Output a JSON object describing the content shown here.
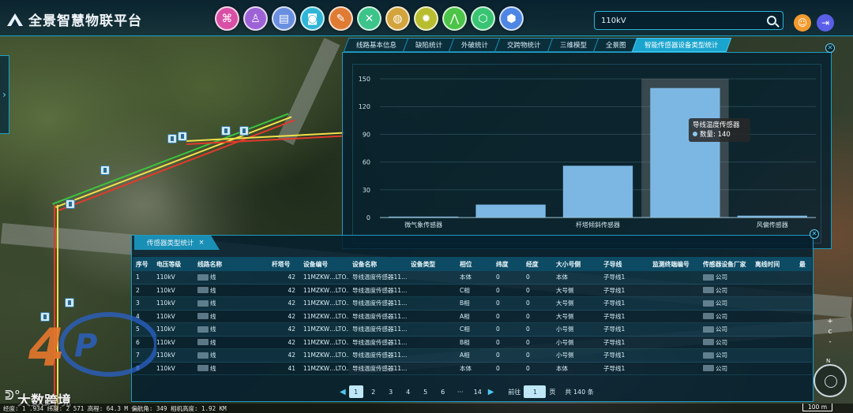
{
  "app": {
    "title": "全景智慧物联平台"
  },
  "nav_icons": [
    {
      "name": "network-icon",
      "color": "#d84fa5",
      "glyph": "⌘"
    },
    {
      "name": "person-icon",
      "color": "#9d63d6",
      "glyph": "♙"
    },
    {
      "name": "layers-icon",
      "color": "#6a8fe0",
      "glyph": "▤"
    },
    {
      "name": "camera-icon",
      "color": "#2fb5d6",
      "glyph": "◙"
    },
    {
      "name": "stamp-icon",
      "color": "#e07b34",
      "glyph": "✎"
    },
    {
      "name": "tools-icon",
      "color": "#3cc48a",
      "glyph": "✕"
    },
    {
      "name": "globe-icon",
      "color": "#d3a43c",
      "glyph": "◍"
    },
    {
      "name": "gear-icon",
      "color": "#b7bd2f",
      "glyph": "✹"
    },
    {
      "name": "line-chart-icon",
      "color": "#4bc447",
      "glyph": "⋀"
    },
    {
      "name": "cube-icon",
      "color": "#39c473",
      "glyph": "⬡"
    },
    {
      "name": "shield-icon",
      "color": "#4e86e3",
      "glyph": "⬢"
    }
  ],
  "search": {
    "value": "110kV"
  },
  "tabs": [
    {
      "label": "线路基本信息",
      "active": false
    },
    {
      "label": "缺陷统计",
      "active": false
    },
    {
      "label": "外破统计",
      "active": false
    },
    {
      "label": "交跨物统计",
      "active": false
    },
    {
      "label": "三维模型",
      "active": false
    },
    {
      "label": "全景图",
      "active": false
    },
    {
      "label": "智能传感器设备类型统计",
      "active": true
    }
  ],
  "chart_data": {
    "type": "bar",
    "categories": [
      "微气象传感器",
      "",
      "杆塔倾斜传感器",
      "导线温度传感器",
      "风偏传感器"
    ],
    "x_tick_labels_shown": [
      "微气象传感器",
      "杆塔倾斜传感器",
      "风偏传感器"
    ],
    "values": [
      1,
      14,
      56,
      140,
      2
    ],
    "ylim": [
      0,
      150
    ],
    "yticks": [
      0,
      30,
      60,
      90,
      120,
      150
    ],
    "highlight_index": 3,
    "bar_color": "#7cb7e3",
    "grid": true,
    "tooltip": {
      "title": "导线温度传感器",
      "label": "数量",
      "value": "140"
    }
  },
  "table": {
    "tab_label": "传感器类型统计",
    "columns": [
      "序号",
      "电压等级",
      "线路名称",
      "杆塔号",
      "设备编号",
      "设备名称",
      "设备类型",
      "相位",
      "纬度",
      "经度",
      "大小号侧",
      "子导线",
      "监测终端编号",
      "传感器设备厂家",
      "离线时间",
      "最"
    ],
    "rows": [
      [
        "1",
        "110kV",
        "线",
        "42",
        "11MZKW…LTO…",
        "导线温度传感器11…",
        "",
        "本体",
        "0",
        "0",
        "本体",
        "子导线1",
        "",
        "公司",
        "",
        ""
      ],
      [
        "2",
        "110kV",
        "线",
        "42",
        "11MZKW…LTO…",
        "导线温度传感器11…",
        "",
        "C相",
        "0",
        "0",
        "大号侧",
        "子导线1",
        "",
        "公司",
        "",
        ""
      ],
      [
        "3",
        "110kV",
        "线",
        "42",
        "11MZKW…LTO…",
        "导线温度传感器11…",
        "",
        "B相",
        "0",
        "0",
        "大号侧",
        "子导线1",
        "",
        "公司",
        "",
        ""
      ],
      [
        "4",
        "110kV",
        "线",
        "42",
        "11MZKW…LTO…",
        "导线温度传感器11…",
        "",
        "A相",
        "0",
        "0",
        "大号侧",
        "子导线1",
        "",
        "公司",
        "",
        ""
      ],
      [
        "5",
        "110kV",
        "线",
        "42",
        "11MZKW…LTO…",
        "导线温度传感器11…",
        "",
        "C相",
        "0",
        "0",
        "小号侧",
        "子导线1",
        "",
        "公司",
        "",
        ""
      ],
      [
        "6",
        "110kV",
        "线",
        "42",
        "11MZKW…LTO…",
        "导线温度传感器11…",
        "",
        "B相",
        "0",
        "0",
        "小号侧",
        "子导线1",
        "",
        "公司",
        "",
        ""
      ],
      [
        "7",
        "110kV",
        "线",
        "42",
        "11MZKW…LTO…",
        "导线温度传感器11…",
        "",
        "A相",
        "0",
        "0",
        "小号侧",
        "子导线1",
        "",
        "公司",
        "",
        ""
      ],
      [
        "8",
        "110kV",
        "线",
        "41",
        "11MZKW…LTO…",
        "导线温度传感器11…",
        "",
        "本体",
        "0",
        "0",
        "本体",
        "子导线1",
        "",
        "公司",
        "",
        ""
      ]
    ]
  },
  "pager": {
    "pages": [
      "1",
      "2",
      "3",
      "4",
      "5",
      "6",
      "···",
      "14"
    ],
    "active": "1",
    "goto_label": "前往",
    "goto_value": "1",
    "page_unit": "页",
    "total_text": "共 140 条"
  },
  "watermark": {
    "text": "大数跨境"
  },
  "status": {
    "text": "经度: 1   .934 纬度: 2       571 高程: 64.3 M 偏航角: 349 相机高度: 1.92 KM"
  },
  "scale": {
    "label": "100 m"
  },
  "compass": {
    "label": "N"
  },
  "zoom": {
    "plus": "+",
    "reset": "c",
    "minus": "-"
  },
  "colors": {
    "accent": "#1aa5cf",
    "panel_bg": "#05202e",
    "border": "#1e9bc1"
  }
}
